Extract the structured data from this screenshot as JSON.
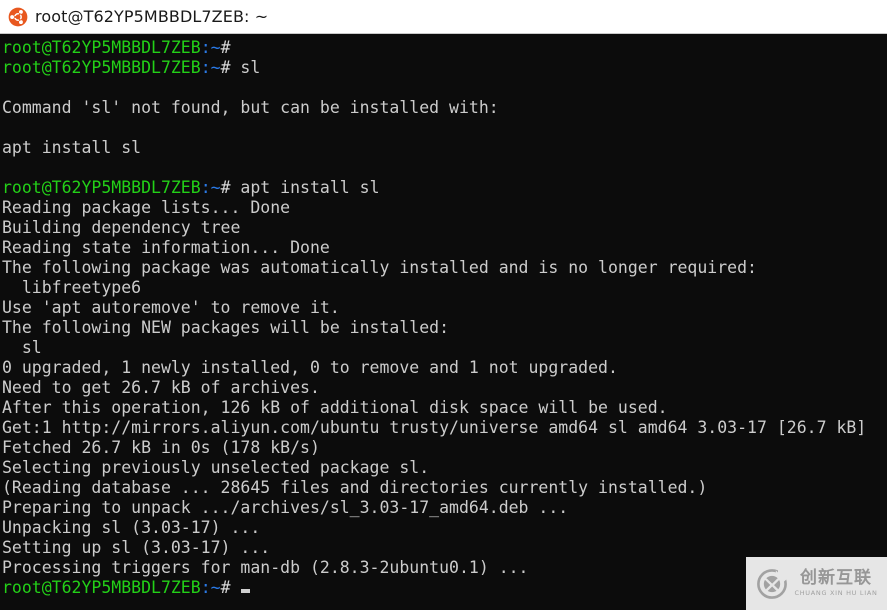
{
  "window": {
    "titlebar": {
      "icon": "ubuntu-logo-icon",
      "title": "root@T62YP5MBBDL7ZEB: ~"
    }
  },
  "terminal": {
    "colors": {
      "background": "#0c0c0c",
      "foreground": "#d0d0d0",
      "prompt_user_host": "#23d018",
      "prompt_path": "#2a7ae8",
      "prompt_sigil": "#d8d8d8"
    },
    "prompt": {
      "user_host": "root@T62YP5MBBDL7ZEB",
      "separator": ":",
      "path": "~",
      "sigil": "#"
    },
    "lines": [
      {
        "type": "prompt",
        "command": ""
      },
      {
        "type": "prompt",
        "command": " sl"
      },
      {
        "type": "blank",
        "text": ""
      },
      {
        "type": "output",
        "text": "Command 'sl' not found, but can be installed with:"
      },
      {
        "type": "blank",
        "text": ""
      },
      {
        "type": "output",
        "text": "apt install sl"
      },
      {
        "type": "blank",
        "text": ""
      },
      {
        "type": "prompt",
        "command": " apt install sl"
      },
      {
        "type": "output",
        "text": "Reading package lists... Done"
      },
      {
        "type": "output",
        "text": "Building dependency tree"
      },
      {
        "type": "output",
        "text": "Reading state information... Done"
      },
      {
        "type": "output",
        "text": "The following package was automatically installed and is no longer required:"
      },
      {
        "type": "output",
        "text": "  libfreetype6"
      },
      {
        "type": "output",
        "text": "Use 'apt autoremove' to remove it."
      },
      {
        "type": "output",
        "text": "The following NEW packages will be installed:"
      },
      {
        "type": "output",
        "text": "  sl"
      },
      {
        "type": "output",
        "text": "0 upgraded, 1 newly installed, 0 to remove and 1 not upgraded."
      },
      {
        "type": "output",
        "text": "Need to get 26.7 kB of archives."
      },
      {
        "type": "output",
        "text": "After this operation, 126 kB of additional disk space will be used."
      },
      {
        "type": "output",
        "text": "Get:1 http://mirrors.aliyun.com/ubuntu trusty/universe amd64 sl amd64 3.03-17 [26.7 kB]"
      },
      {
        "type": "output",
        "text": "Fetched 26.7 kB in 0s (178 kB/s)"
      },
      {
        "type": "output",
        "text": "Selecting previously unselected package sl."
      },
      {
        "type": "output",
        "text": "(Reading database ... 28645 files and directories currently installed.)"
      },
      {
        "type": "output",
        "text": "Preparing to unpack .../archives/sl_3.03-17_amd64.deb ..."
      },
      {
        "type": "output",
        "text": "Unpacking sl (3.03-17) ..."
      },
      {
        "type": "output",
        "text": "Setting up sl (3.03-17) ..."
      },
      {
        "type": "output",
        "text": "Processing triggers for man-db (2.8.3-2ubuntu0.1) ..."
      },
      {
        "type": "prompt-cursor",
        "command": " "
      }
    ]
  },
  "watermark": {
    "logo": "cx-logo-icon",
    "chinese": "创新互联",
    "pinyin": "CHUANG XIN HU LIAN",
    "background": "#efefef",
    "text_color": "#9d9d9d"
  }
}
